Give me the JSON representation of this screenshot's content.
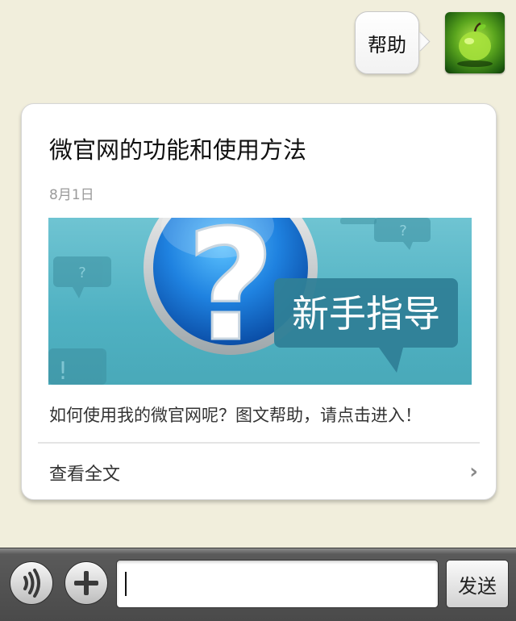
{
  "chat": {
    "outgoing_message": "帮助"
  },
  "article": {
    "title": "微官网的功能和使用方法",
    "date": "8月1日",
    "cover_text": "新手指导",
    "description": "如何使用我的微官网呢？图文帮助，请点击进入！",
    "read_more": "查看全文"
  },
  "input_bar": {
    "text_value": "",
    "send_label": "发送"
  },
  "icons": {
    "voice": "voice-wave-icon",
    "plus": "plus-icon",
    "chevron": "chevron-right-icon",
    "cover": "question-mark-icon"
  },
  "colors": {
    "background": "#f1eedc",
    "cover_teal": "#4fb1c2",
    "bar": "#4a4a4a"
  }
}
